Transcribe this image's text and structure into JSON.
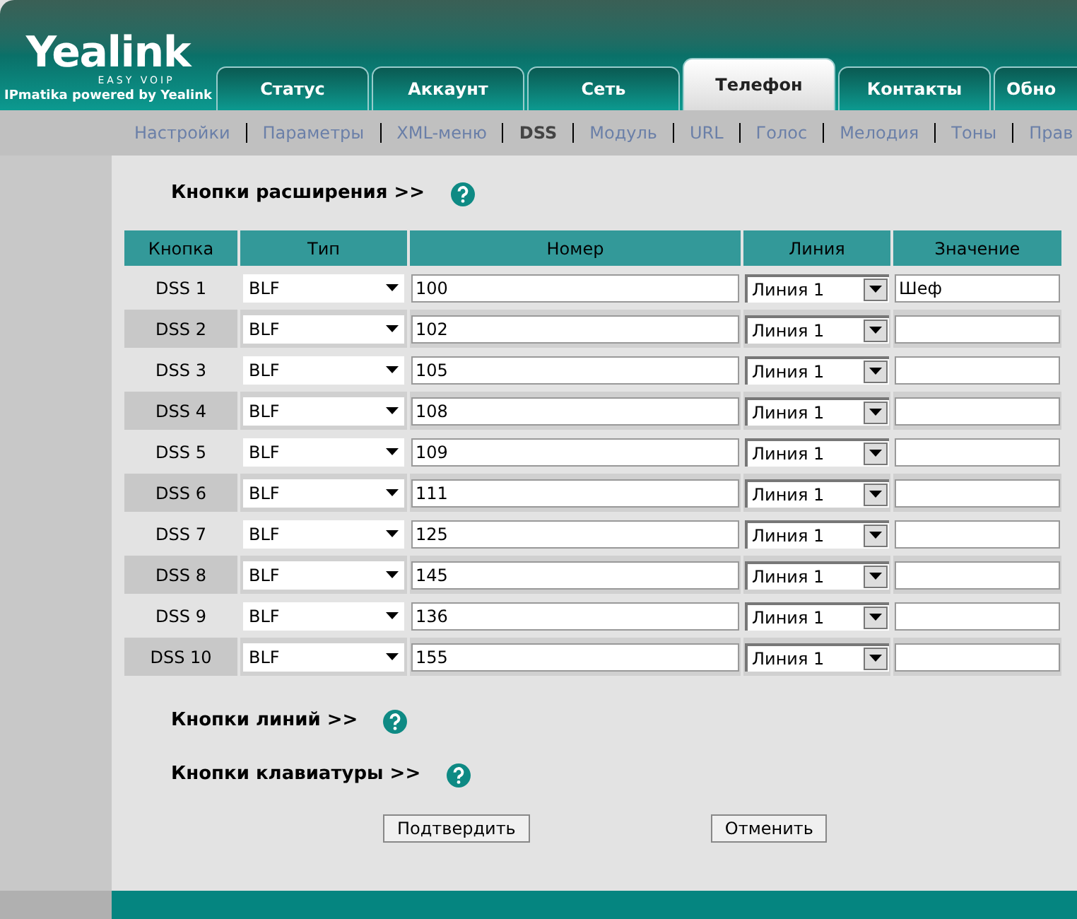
{
  "logo": {
    "name": "Yealink",
    "tagline": "EASY VOIP",
    "subtitle": "IPmatika powered by Yealink"
  },
  "tabs": [
    {
      "label": "Статус",
      "selected": false
    },
    {
      "label": "Аккаунт",
      "selected": false
    },
    {
      "label": "Сеть",
      "selected": false
    },
    {
      "label": "Телефон",
      "selected": true
    },
    {
      "label": "Контакты",
      "selected": false
    },
    {
      "label": "Обно",
      "selected": false
    }
  ],
  "subnav": [
    {
      "label": "Настройки",
      "selected": false
    },
    {
      "label": "Параметры",
      "selected": false
    },
    {
      "label": "XML-меню",
      "selected": false
    },
    {
      "label": "DSS",
      "selected": true
    },
    {
      "label": "Модуль",
      "selected": false
    },
    {
      "label": "URL",
      "selected": false
    },
    {
      "label": "Голос",
      "selected": false
    },
    {
      "label": "Мелодия",
      "selected": false
    },
    {
      "label": "Тоны",
      "selected": false
    },
    {
      "label": "Прав",
      "selected": false
    }
  ],
  "section_title": "Кнопки расширения >>",
  "table": {
    "columns": [
      "Кнопка",
      "Тип",
      "Номер",
      "Линия",
      "Значение"
    ],
    "rows": [
      {
        "key": "DSS 1",
        "type": "BLF",
        "number": "100",
        "line": "Линия 1",
        "value": "Шеф"
      },
      {
        "key": "DSS 2",
        "type": "BLF",
        "number": "102",
        "line": "Линия 1"
      },
      {
        "key": "DSS 3",
        "type": "BLF",
        "number": "105",
        "line": "Линия 1"
      },
      {
        "key": "DSS 4",
        "type": "BLF",
        "number": "108",
        "line": "Линия 1"
      },
      {
        "key": "DSS 5",
        "type": "BLF",
        "number": "109",
        "line": "Линия 1"
      },
      {
        "key": "DSS 6",
        "type": "BLF",
        "number": "111",
        "line": "Линия 1"
      },
      {
        "key": "DSS 7",
        "type": "BLF",
        "number": "125",
        "line": "Линия 1"
      },
      {
        "key": "DSS 8",
        "type": "BLF",
        "number": "145",
        "line": "Линия 1"
      },
      {
        "key": "DSS 9",
        "type": "BLF",
        "number": "136",
        "line": "Линия 1"
      },
      {
        "key": "DSS 10",
        "type": "BLF",
        "number": "155",
        "line": "Линия 1"
      }
    ]
  },
  "sections": [
    "Кнопки линий >>",
    "Кнопки клавиатуры >>"
  ],
  "buttons": [
    "Подтвердить",
    "Отменить"
  ]
}
